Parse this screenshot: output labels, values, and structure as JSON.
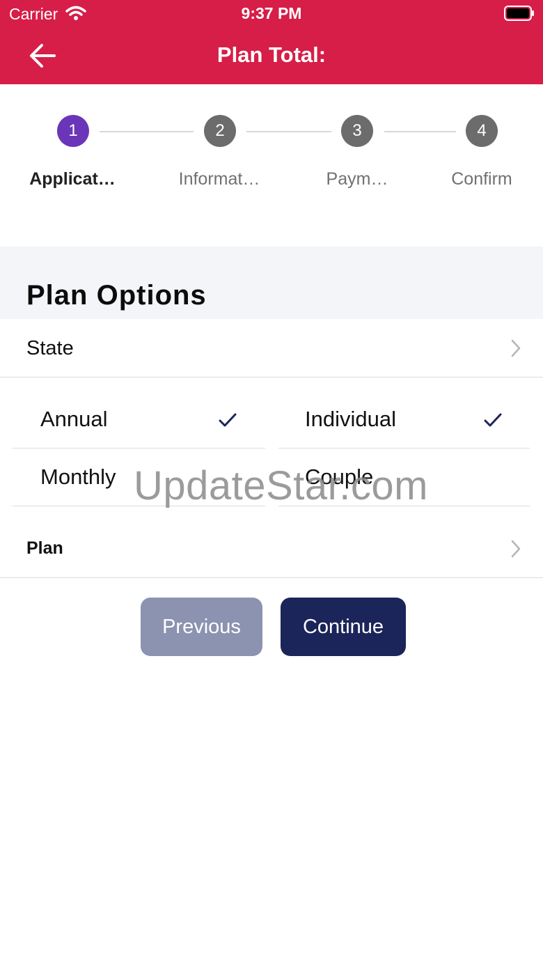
{
  "status_bar": {
    "carrier": "Carrier",
    "time": "9:37 PM"
  },
  "nav": {
    "title": "Plan Total:"
  },
  "stepper": {
    "steps": [
      {
        "number": "1",
        "label": "Applicat…"
      },
      {
        "number": "2",
        "label": "Informat…"
      },
      {
        "number": "3",
        "label": "Paym…"
      },
      {
        "number": "4",
        "label": "Confirm"
      }
    ],
    "active_step": 1
  },
  "section": {
    "title": "Plan Options"
  },
  "state_row": {
    "label": "State"
  },
  "billing_options": [
    {
      "label": "Annual",
      "checked": true
    },
    {
      "label": "Monthly",
      "checked": false
    }
  ],
  "coverage_options": [
    {
      "label": "Individual",
      "checked": true
    },
    {
      "label": "Couple",
      "checked": false
    }
  ],
  "plan_row": {
    "label": "Plan"
  },
  "buttons": {
    "previous": "Previous",
    "continue": "Continue"
  },
  "watermark": "UpdateStar.com",
  "colors": {
    "header": "#d61e48",
    "active_step": "#6a35b8",
    "inactive_step": "#6c6c6c",
    "continue_button": "#1b2559",
    "previous_button": "#8c93b0",
    "checkmark": "#1b2559"
  }
}
